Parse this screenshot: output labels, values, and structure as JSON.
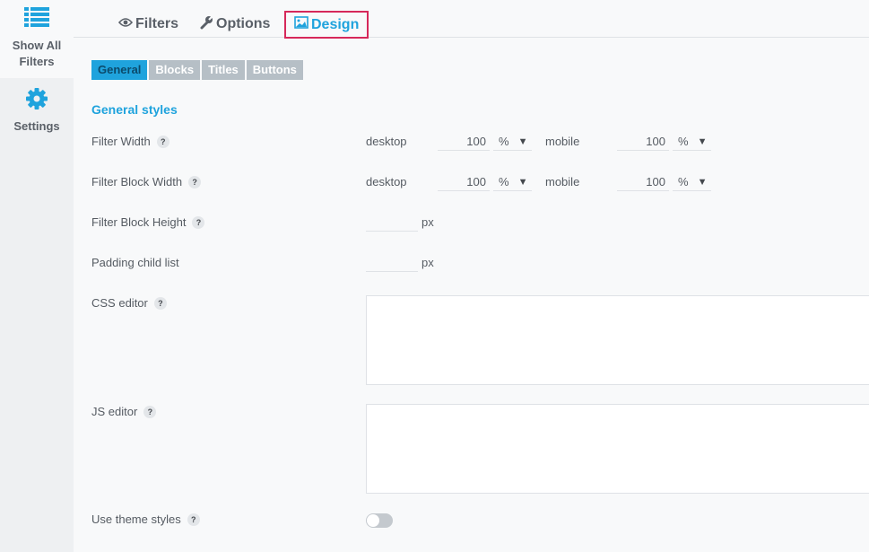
{
  "sidebar": {
    "items": [
      {
        "label": "Show All Filters",
        "icon": "list-icon",
        "active": true
      },
      {
        "label": "Settings",
        "icon": "gear-icon",
        "active": false
      }
    ]
  },
  "tabs": [
    {
      "label": "Filters",
      "icon": "eye-icon"
    },
    {
      "label": "Options",
      "icon": "wrench-icon"
    },
    {
      "label": "Design",
      "icon": "image-icon",
      "active": true
    }
  ],
  "subtabs": [
    {
      "label": "General",
      "active": true
    },
    {
      "label": "Blocks"
    },
    {
      "label": "Titles"
    },
    {
      "label": "Buttons"
    }
  ],
  "section_title": "General styles",
  "help_glyph": "?",
  "rows": {
    "filter_width": {
      "label": "Filter Width",
      "desktop_label": "desktop",
      "desktop_value": "100",
      "desktop_unit": "%",
      "mobile_label": "mobile",
      "mobile_value": "100",
      "mobile_unit": "%"
    },
    "filter_block_width": {
      "label": "Filter Block Width",
      "desktop_label": "desktop",
      "desktop_value": "100",
      "desktop_unit": "%",
      "mobile_label": "mobile",
      "mobile_value": "100",
      "mobile_unit": "%"
    },
    "filter_block_height": {
      "label": "Filter Block Height",
      "value": "",
      "unit": "px"
    },
    "padding_child_list": {
      "label": "Padding child list",
      "value": "",
      "unit": "px"
    },
    "css_editor": {
      "label": "CSS editor",
      "value": ""
    },
    "js_editor": {
      "label": "JS editor",
      "value": ""
    },
    "use_theme_styles": {
      "label": "Use theme styles",
      "enabled": false
    }
  },
  "dropdown_arrow": "▼",
  "colors": {
    "accent": "#1fa3dd",
    "highlight_border": "#d6285a",
    "subtab_inactive": "#b6bfc6",
    "sidebar_bg": "#eef0f2"
  }
}
